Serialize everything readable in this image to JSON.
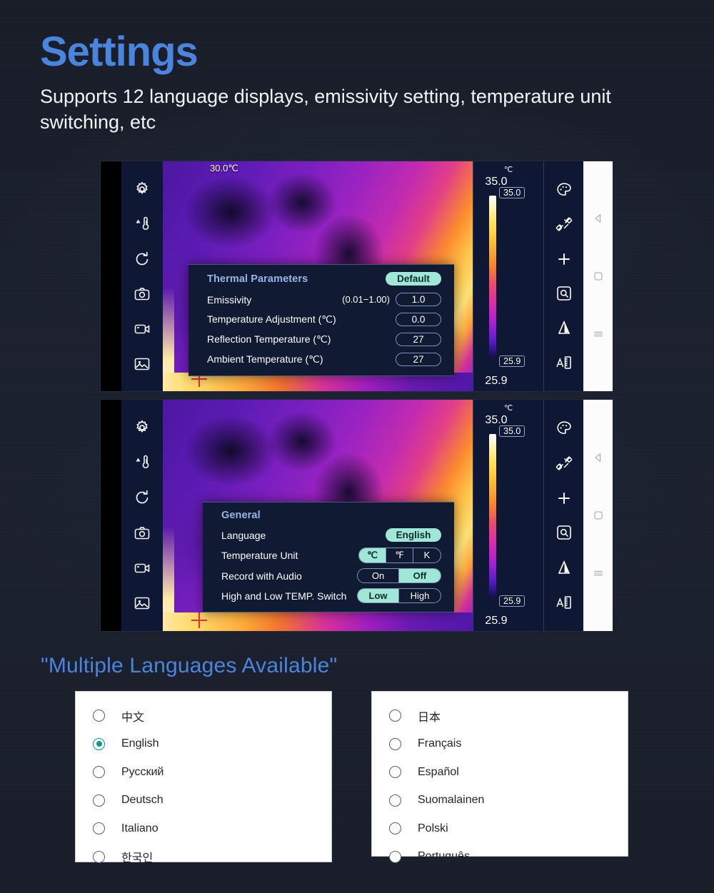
{
  "header": {
    "title": "Settings",
    "subtitle": "Supports 12 language displays, emissivity setting, temperature unit switching, etc",
    "title_color": "#4a85dd"
  },
  "devices": [
    {
      "sidebar_icons": [
        "gear-icon",
        "temperature-alarm-icon",
        "refresh-icon",
        "camera-icon",
        "video-icon",
        "gallery-icon"
      ],
      "scale": {
        "unit": "℃",
        "max": "35.0",
        "min": "25.9",
        "tag_top": "35.0",
        "tag_bottom": "25.9"
      },
      "rail_icons": [
        "palette-icon",
        "measure-tools-icon",
        "plus-icon",
        "magnifier-box-icon",
        "contrast-icon",
        "font-size-icon"
      ],
      "nav_icons": [
        "back-icon",
        "home-icon",
        "menu-icon"
      ],
      "spot": {
        "label": "30.0℃"
      },
      "dialog": {
        "title": "Thermal Parameters",
        "action_label": "Default",
        "rows": [
          {
            "label": "Emissivity",
            "hint": "(0.01−1.00)",
            "value": "1.0"
          },
          {
            "label": "Temperature Adjustment (℃)",
            "hint": "",
            "value": "0.0"
          },
          {
            "label": "Reflection Temperature (℃)",
            "hint": "",
            "value": "27"
          },
          {
            "label": "Ambient Temperature (℃)",
            "hint": "",
            "value": "27"
          }
        ]
      }
    },
    {
      "sidebar_icons": [
        "gear-icon",
        "temperature-alarm-icon",
        "refresh-icon",
        "camera-icon",
        "video-icon",
        "gallery-icon"
      ],
      "scale": {
        "unit": "℃",
        "max": "35.0",
        "min": "25.9",
        "tag_top": "35.0",
        "tag_bottom": "25.9"
      },
      "rail_icons": [
        "palette-icon",
        "measure-tools-icon",
        "plus-icon",
        "magnifier-box-icon",
        "contrast-icon",
        "font-size-icon"
      ],
      "nav_icons": [
        "back-icon",
        "home-icon",
        "menu-icon"
      ],
      "dialog": {
        "title": "General",
        "rows": [
          {
            "label": "Language",
            "type": "pill",
            "value": "English"
          },
          {
            "label": "Temperature Unit",
            "type": "segment",
            "options": [
              "℃",
              "℉",
              "K"
            ],
            "selected": "℃"
          },
          {
            "label": "Record with Audio",
            "type": "segment",
            "options": [
              "On",
              "Off"
            ],
            "selected": "Off"
          },
          {
            "label": "High and Low TEMP. Switch",
            "type": "segment",
            "options": [
              "Low",
              "High"
            ],
            "selected": "Low"
          }
        ]
      }
    }
  ],
  "languages": {
    "heading": "\"Multiple Languages Available\"",
    "selected": "English",
    "left_column": [
      "中文",
      "English",
      "Русский",
      "Deutsch",
      "Italiano",
      "한국인"
    ],
    "right_column": [
      "日本",
      "Français",
      "Español",
      "Suomalainen",
      "Polski",
      "Português"
    ]
  },
  "colors": {
    "accent_blue": "#4a85dd",
    "accent_teal": "#9fe8d8",
    "radio_selected": "#0c9b86"
  }
}
